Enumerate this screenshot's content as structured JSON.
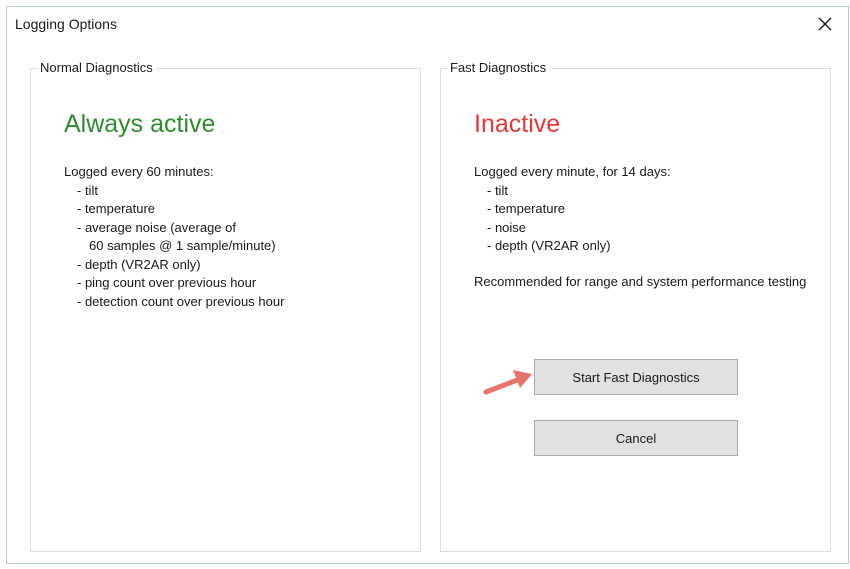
{
  "window": {
    "title": "Logging Options",
    "close_icon": "close-icon"
  },
  "normal": {
    "legend": "Normal Diagnostics",
    "status": "Always active",
    "status_color": "#2e8b2e",
    "intro": "Logged every 60 minutes:",
    "items": [
      "- tilt",
      "- temperature",
      "- average noise (average of",
      "60 samples @ 1 sample/minute)",
      "- depth (VR2AR only)",
      "- ping count over previous hour",
      "- detection count over previous hour"
    ]
  },
  "fast": {
    "legend": "Fast Diagnostics",
    "status": "Inactive",
    "status_color": "#e53935",
    "intro": "Logged every minute, for 14 days:",
    "items": [
      "- tilt",
      "- temperature",
      "- noise",
      "- depth (VR2AR only)"
    ],
    "recommendation": "Recommended for range and system performance testing",
    "start_button": "Start Fast Diagnostics",
    "cancel_button": "Cancel"
  },
  "annotation": {
    "arrow_icon": "arrow-icon",
    "arrow_color": "#e8736a"
  }
}
